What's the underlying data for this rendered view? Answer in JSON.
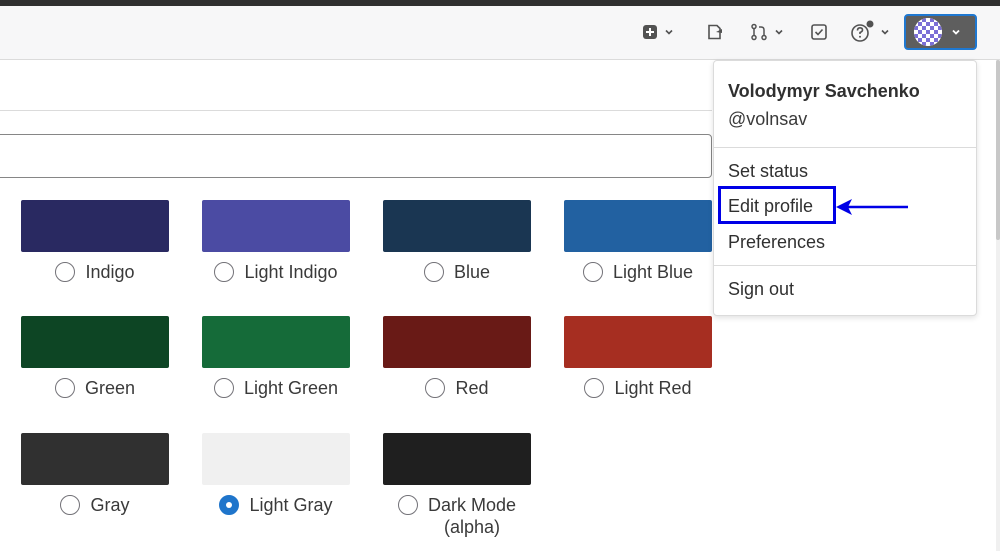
{
  "navbar": {
    "create_icon": "plus-square-icon",
    "snippets_icon": "snippet-icon",
    "merge_requests_icon": "merge-request-icon",
    "todos_icon": "todo-check-icon",
    "help_icon": "question-circle-icon",
    "avatar_icon": "user-avatar"
  },
  "user_menu": {
    "name": "Volodymyr Savchenko",
    "username": "@volnsav",
    "set_status": "Set status",
    "edit_profile": "Edit profile",
    "preferences": "Preferences",
    "sign_out": "Sign out"
  },
  "themes": [
    {
      "label": "Indigo",
      "color": "#292961",
      "checked": false
    },
    {
      "label": "Light Indigo",
      "color": "#4b4ba3",
      "checked": false
    },
    {
      "label": "Blue",
      "color": "#1a3652",
      "checked": false
    },
    {
      "label": "Light Blue",
      "color": "#2261a1",
      "checked": false
    },
    {
      "label": "Green",
      "color": "#0d4524",
      "checked": false
    },
    {
      "label": "Light Green",
      "color": "#156b39",
      "checked": false
    },
    {
      "label": "Red",
      "color": "#691a16",
      "checked": false
    },
    {
      "label": "Light Red",
      "color": "#a62e21",
      "checked": false
    },
    {
      "label": "Gray",
      "color": "#303030",
      "checked": false
    },
    {
      "label": "Light Gray",
      "color": "#f0f0f0",
      "checked": true
    },
    {
      "label": "Dark Mode\n(alpha)",
      "color": "#1f1f1f",
      "checked": false
    }
  ],
  "colors": {
    "highlight": "#0000e6",
    "radio_checked": "#1f75cb"
  }
}
